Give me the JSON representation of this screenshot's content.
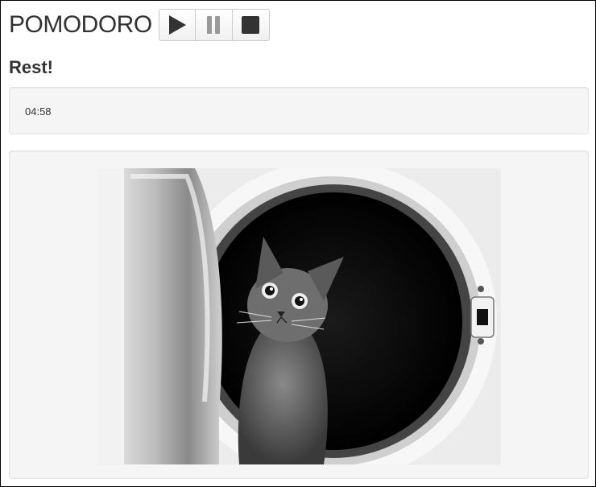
{
  "app": {
    "title": "POMODORO"
  },
  "controls": [
    {
      "icon": "play-icon"
    },
    {
      "icon": "pause-icon"
    },
    {
      "icon": "stop-icon"
    }
  ],
  "status": {
    "text": "Rest!"
  },
  "timer": {
    "value": "04:58"
  },
  "image": {
    "alt": "Kitten sitting inside a washing machine drum (black and white)"
  },
  "colors": {
    "text": "#333333",
    "well_bg": "#f5f5f5",
    "well_border": "#e3e3e3",
    "button_border": "#cccccc"
  }
}
